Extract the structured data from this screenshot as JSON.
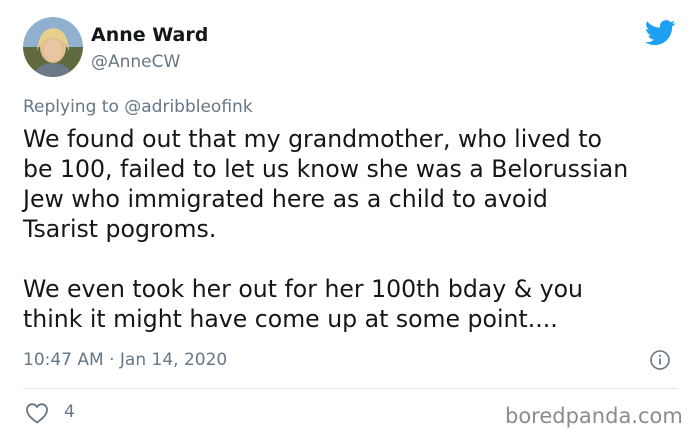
{
  "author": {
    "name": "Anne Ward",
    "handle": "@AnneCW"
  },
  "reply": {
    "prefix": "Replying to ",
    "mention": "@adribbleofink"
  },
  "tweet": {
    "paragraphs": [
      "We found out that my grandmother, who lived to\nbe 100, failed to let us know she was a Belorussian\nJew who immigrated here as a child to avoid\nTsarist pogroms.",
      "We even took her out for her 100th bday & you\nthink it might have come up at some point...."
    ],
    "timestamp": "10:47 AM · Jan 14, 2020"
  },
  "stats": {
    "likes": "4"
  },
  "watermark": "boredpanda.com",
  "colors": {
    "twitter_blue": "#1da1f2",
    "muted_text": "#657786",
    "divider": "#e1e8ed"
  },
  "icons": {
    "brand": "twitter-bird-icon",
    "info": "info-icon",
    "like": "heart-icon"
  }
}
